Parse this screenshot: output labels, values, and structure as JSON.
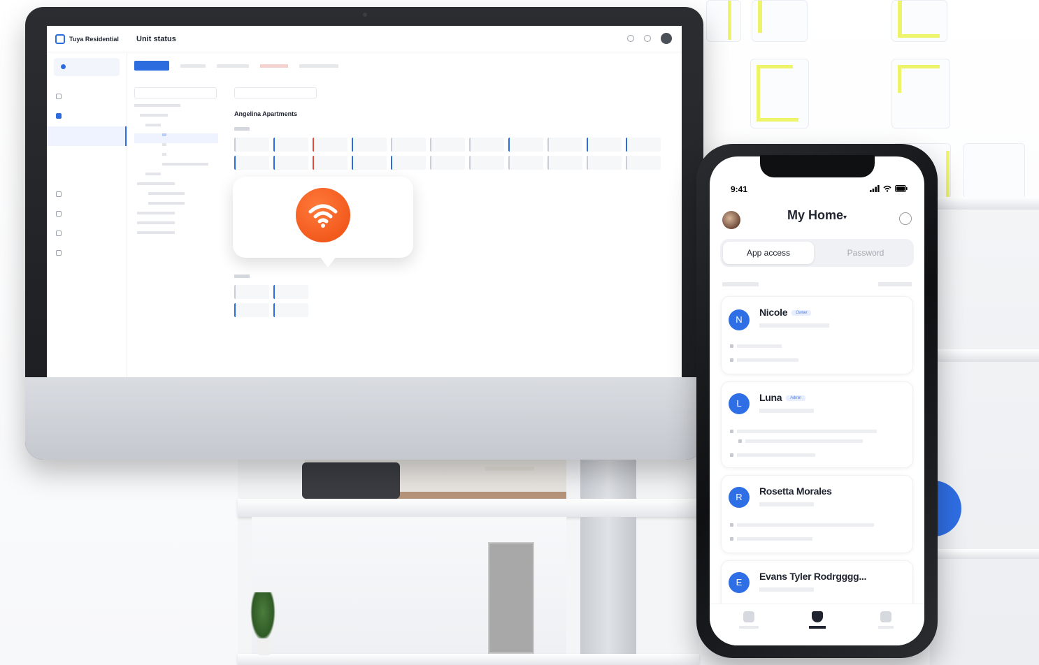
{
  "desktop": {
    "brand": "Tuya Residential",
    "page_title": "Unit status",
    "building_name": "Angelina Apartments"
  },
  "phone": {
    "time": "9:41",
    "home_title": "My Home",
    "tabs": [
      "App access",
      "Password"
    ],
    "users": [
      {
        "initial": "N",
        "name": "Nicole",
        "badge": "Owner"
      },
      {
        "initial": "L",
        "name": "Luna",
        "badge": "Admin"
      },
      {
        "initial": "R",
        "name": "Rosetta Morales",
        "badge": ""
      },
      {
        "initial": "E",
        "name": "Evans Tyler Rodrgggg...",
        "badge": ""
      }
    ]
  },
  "colors": {
    "accent": "#2d6cdf",
    "wifi_orange": "#f25a1d",
    "avatar_blue": "#2f6fe5"
  },
  "icons": {
    "wifi": "wifi-icon",
    "add": "add-circle-icon",
    "signal": "signal-icon"
  }
}
